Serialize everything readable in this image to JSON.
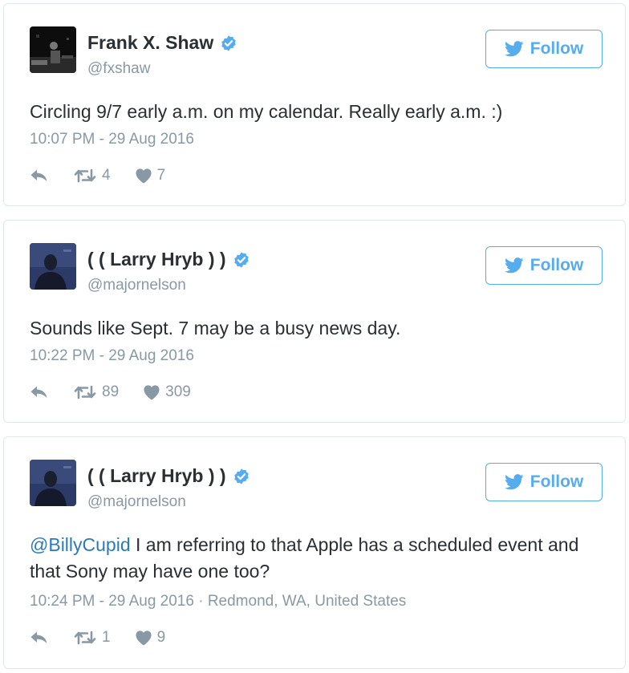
{
  "colors": {
    "accent": "#55acee",
    "link": "#2b7bb9",
    "muted": "#8899a6",
    "text": "#292f33",
    "verified": "#55acee"
  },
  "follow_icon": "twitter-bird-icon",
  "tweets": [
    {
      "display_name": "Frank X. Shaw",
      "handle": "@fxshaw",
      "verified": true,
      "follow_label": "Follow",
      "mention": "",
      "text": "Circling 9/7 early a.m. on my calendar. Really early a.m. :)",
      "timestamp": "10:07 PM - 29 Aug 2016",
      "location": "",
      "retweets": "4",
      "likes": "7"
    },
    {
      "display_name": "( ( Larry Hryb ) )",
      "handle": "@majornelson",
      "verified": true,
      "follow_label": "Follow",
      "mention": "",
      "text": "Sounds like Sept. 7 may be a busy news day.",
      "timestamp": "10:22 PM - 29 Aug 2016",
      "location": "",
      "retweets": "89",
      "likes": "309"
    },
    {
      "display_name": "( ( Larry Hryb ) )",
      "handle": "@majornelson",
      "verified": true,
      "follow_label": "Follow",
      "mention": "@BillyCupid",
      "text": " I am referring to that Apple has a scheduled event and that Sony may have one too?",
      "timestamp": "10:24 PM - 29 Aug 2016",
      "location": " · Redmond, WA, United States",
      "retweets": "1",
      "likes": "9"
    }
  ]
}
